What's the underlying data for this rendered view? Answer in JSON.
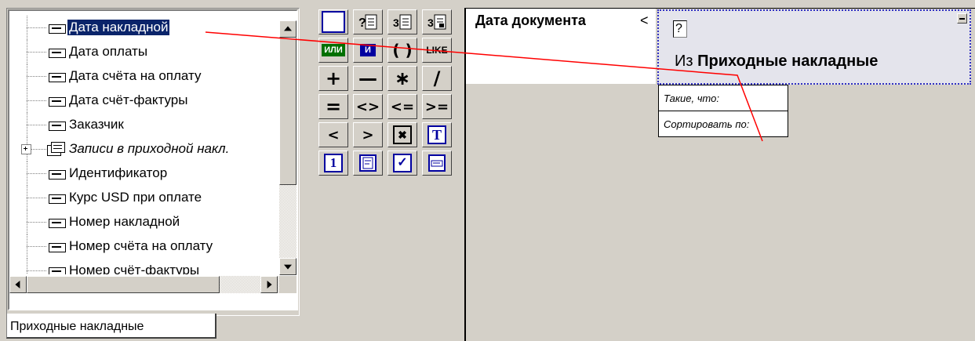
{
  "tree": {
    "items": [
      {
        "label": "Дата накладной",
        "type": "field",
        "selected": true
      },
      {
        "label": "Дата оплаты",
        "type": "field"
      },
      {
        "label": "Дата счёта на оплату",
        "type": "field"
      },
      {
        "label": "Дата счёт-фактуры",
        "type": "field"
      },
      {
        "label": "Заказчик",
        "type": "field"
      },
      {
        "label": "Записи в приходной накл.",
        "type": "table"
      },
      {
        "label": "Идентификатор",
        "type": "field"
      },
      {
        "label": "Курс USD при оплате",
        "type": "field"
      },
      {
        "label": "Номер накладной",
        "type": "field"
      },
      {
        "label": "Номер счёта на оплату",
        "type": "field"
      },
      {
        "label": "Номер счёт-фактуры",
        "type": "field"
      }
    ]
  },
  "tab": {
    "label": "Приходные накладные"
  },
  "toolbox": {
    "row2": {
      "or_label": "ИЛИ",
      "and_label": "И",
      "paren_label": "( )",
      "like_label": "LIKE"
    },
    "row3": {
      "plus": "+",
      "minus": "—",
      "mult": "∗",
      "div": "/"
    },
    "row4": {
      "eq": "=",
      "neq": "<>",
      "le": "<=",
      "ge": ">="
    },
    "row5": {
      "lt": "<",
      "gt": ">",
      "x": "✖",
      "t": "T"
    },
    "row6": {
      "one": "1",
      "check": "✓"
    }
  },
  "query": {
    "header": "Дата документа",
    "header_op": "<",
    "source_placeholder": "?",
    "source_prefix": "Из ",
    "source_name": "Приходные накладные",
    "where_label": "Такие, что:",
    "order_label": "Сортировать по:"
  },
  "colors": {
    "selection": "#0a246a",
    "link_line": "#ff0000",
    "accent_blue": "#0000a0"
  }
}
